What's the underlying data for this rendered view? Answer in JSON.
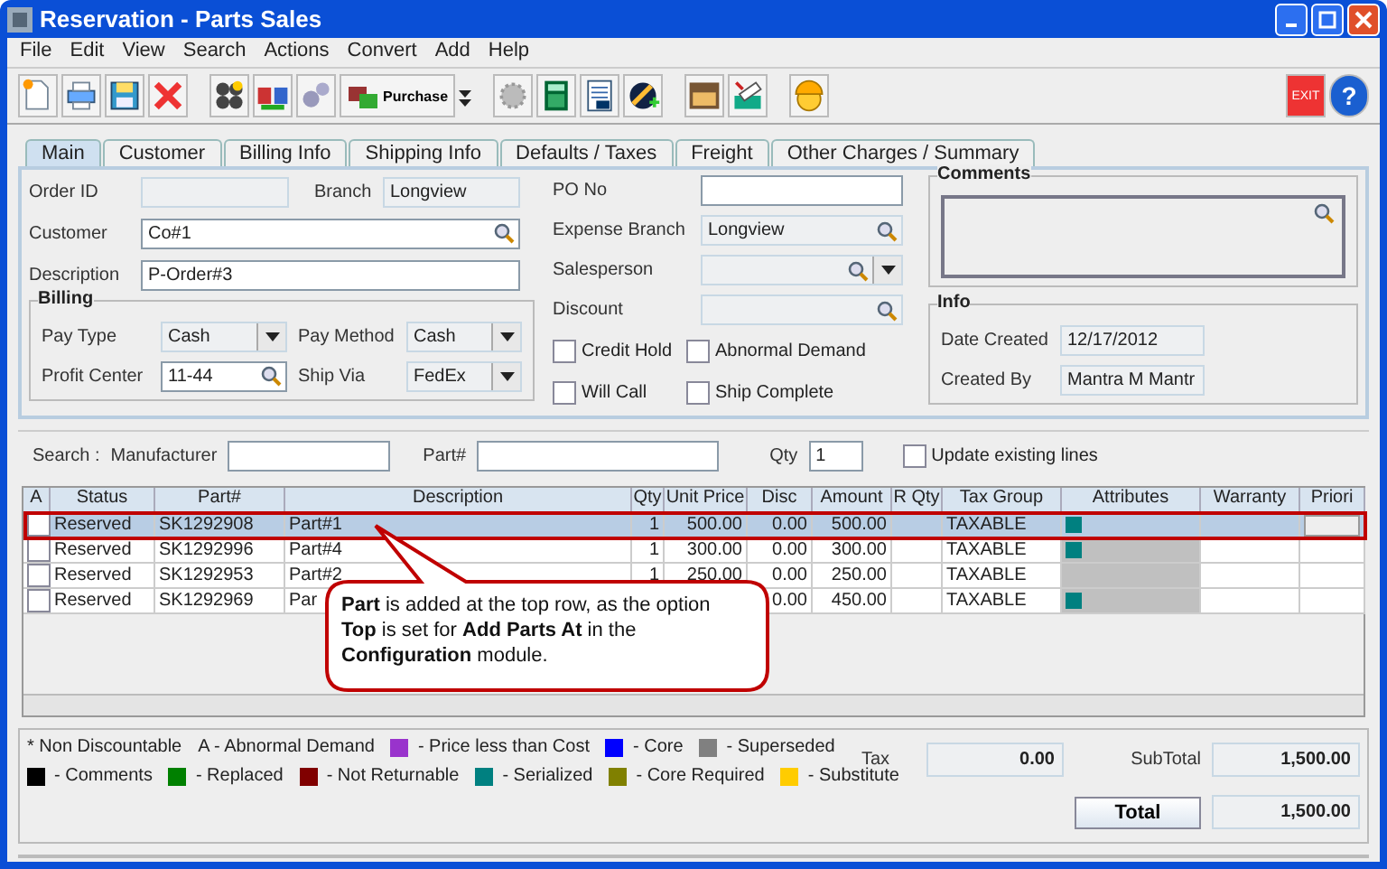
{
  "window": {
    "title": "Reservation - Parts Sales"
  },
  "menu": [
    {
      "label": "File"
    },
    {
      "label": "Edit"
    },
    {
      "label": "View"
    },
    {
      "label": "Search"
    },
    {
      "label": "Actions"
    },
    {
      "label": "Convert"
    },
    {
      "label": "Add"
    },
    {
      "label": "Help"
    }
  ],
  "toolbar": {
    "purchase_label": "Purchase",
    "exit_label": "EXIT",
    "help_label": "?"
  },
  "tabs": [
    {
      "label": "Main",
      "selected": true
    },
    {
      "label": "Customer",
      "selected": false
    },
    {
      "label": "Billing Info",
      "selected": false
    },
    {
      "label": "Shipping Info",
      "selected": false
    },
    {
      "label": "Defaults / Taxes",
      "selected": false
    },
    {
      "label": "Freight",
      "selected": false
    },
    {
      "label": "Other Charges / Summary",
      "selected": false
    }
  ],
  "form": {
    "order_id": {
      "label": "Order ID"
    },
    "branch": {
      "label": "Branch",
      "value": "Longview"
    },
    "customer": {
      "label": "Customer",
      "value": "Co#1"
    },
    "description": {
      "label": "Description",
      "value": "P-Order#3"
    },
    "billing": {
      "title": "Billing",
      "pay_type": {
        "label": "Pay Type",
        "value": "Cash"
      },
      "pay_method": {
        "label": "Pay Method",
        "value": "Cash"
      },
      "profit_center": {
        "label": "Profit Center",
        "value": "11-44"
      },
      "ship_via": {
        "label": "Ship Via",
        "value": "FedEx"
      }
    },
    "po_no": {
      "label": "PO No"
    },
    "expense_branch": {
      "label": "Expense Branch",
      "value": "Longview"
    },
    "salesperson": {
      "label": "Salesperson"
    },
    "discount": {
      "label": "Discount"
    },
    "checks": [
      {
        "label": "Credit Hold",
        "checked": false
      },
      {
        "label": "Abnormal Demand",
        "checked": false
      },
      {
        "label": "Will Call",
        "checked": false
      },
      {
        "label": "Ship Complete",
        "checked": false
      }
    ],
    "comments": {
      "title": "Comments"
    },
    "info": {
      "title": "Info",
      "date_created": {
        "label": "Date Created",
        "value": "12/17/2012"
      },
      "created_by": {
        "label": "Created By",
        "value": "Mantra M Mantr"
      }
    }
  },
  "search": {
    "title": "Search :",
    "manufacturer_label": "Manufacturer",
    "part_label": "Part#",
    "qty_label": "Qty",
    "qty_value": "1",
    "update_label": "Update existing lines",
    "update_checked": false
  },
  "table": {
    "columns": [
      "A",
      "Status",
      "Part#",
      "Description",
      "Qty",
      "Unit Price",
      "Disc",
      "Amount",
      "R Qty",
      "Tax Group",
      "Attributes",
      "Warranty",
      "Priori"
    ],
    "rows": [
      {
        "selected": true,
        "checked": false,
        "status": "Reserved",
        "part": "SK1292908",
        "description": "Part#1",
        "qty": "1",
        "unit_price": "500.00",
        "disc": "0.00",
        "amount": "500.00",
        "tax_group": "TAXABLE",
        "color": "#008080"
      },
      {
        "selected": false,
        "checked": false,
        "status": "Reserved",
        "part": "SK1292996",
        "description": "Part#4",
        "qty": "1",
        "unit_price": "300.00",
        "disc": "0.00",
        "amount": "300.00",
        "tax_group": "TAXABLE",
        "color": "#008080"
      },
      {
        "selected": false,
        "checked": false,
        "status": "Reserved",
        "part": "SK1292953",
        "description": "Part#2",
        "qty": "1",
        "unit_price": "250.00",
        "disc": "0.00",
        "amount": "250.00",
        "tax_group": "TAXABLE"
      },
      {
        "selected": false,
        "checked": false,
        "status": "Reserved",
        "part": "SK1292969",
        "description": "Par",
        "disc": "0.00",
        "amount": "450.00",
        "tax_group": "TAXABLE",
        "color": "#008080"
      }
    ]
  },
  "callout": {
    "text": "**Part** is added at the top row, as the option **Top** is set for **Add Parts At** in the **Configuration** module."
  },
  "legend": {
    "notes": [
      "* Non Discountable",
      "A - Abnormal Demand"
    ],
    "items": [
      {
        "label": "- Price less than Cost",
        "color": "#9933cc"
      },
      {
        "label": "- Core",
        "color": "#0000ff"
      },
      {
        "label": "- Superseded",
        "color": "#808080"
      },
      {
        "label": "- Comments",
        "color": "#000000"
      },
      {
        "label": "- Replaced",
        "color": "#008000"
      },
      {
        "label": "- Not Returnable",
        "color": "#800000"
      },
      {
        "label": "- Serialized",
        "color": "#008080"
      },
      {
        "label": "- Core Required",
        "color": "#808000"
      },
      {
        "label": "- Substitute",
        "color": "#ffcc00"
      }
    ]
  },
  "totals": {
    "tax_label": "Tax",
    "tax": "0.00",
    "subtotal_label": "SubTotal",
    "subtotal": "1,500.00",
    "total_button": "Total",
    "total": "1,500.00"
  }
}
